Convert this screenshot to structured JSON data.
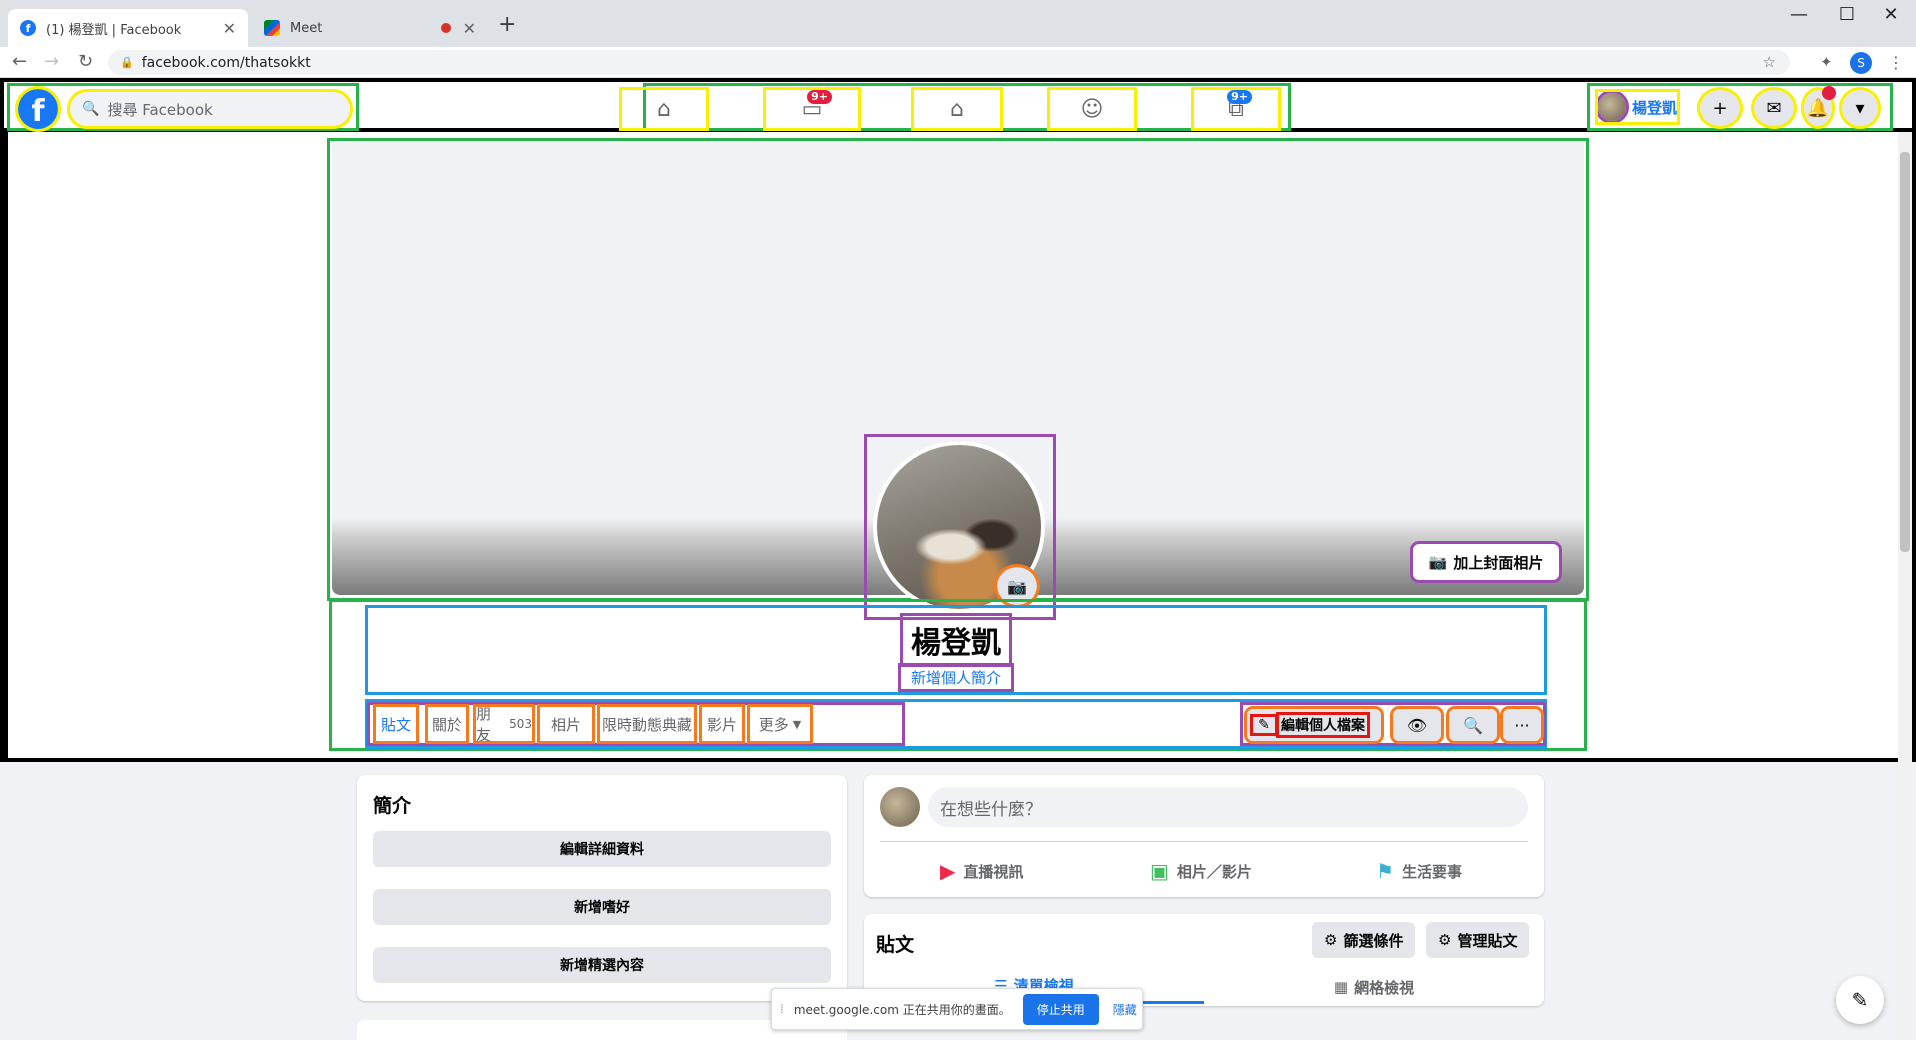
{
  "browser": {
    "tabs": [
      {
        "title": "(1) 楊登凱 | Facebook",
        "icon": "facebook-icon"
      },
      {
        "title": "Meet",
        "icon": "meet-icon"
      }
    ],
    "new_tab": "+",
    "url": "facebook.com/thatsokkt",
    "profile_initial": "S"
  },
  "fb_header": {
    "logo": "f",
    "search_placeholder": "搜尋 Facebook",
    "nav": [
      {
        "name": "home",
        "icon": "home-icon",
        "badge": ""
      },
      {
        "name": "watch",
        "icon": "video-icon",
        "badge": "9+"
      },
      {
        "name": "marketplace",
        "icon": "store-icon",
        "badge": ""
      },
      {
        "name": "groups",
        "icon": "groups-icon",
        "badge": ""
      },
      {
        "name": "gaming",
        "icon": "gaming-icon",
        "badge": "9+"
      }
    ],
    "profile_name": "楊登凱"
  },
  "profile": {
    "add_cover_label": "加上封面相片",
    "name": "楊登凱",
    "add_bio": "新增個人簡介",
    "tabs": [
      {
        "label": "貼文",
        "count": ""
      },
      {
        "label": "關於",
        "count": ""
      },
      {
        "label": "朋友",
        "count": "503"
      },
      {
        "label": "相片",
        "count": ""
      },
      {
        "label": "限時動態典藏",
        "count": ""
      },
      {
        "label": "影片",
        "count": ""
      },
      {
        "label": "更多",
        "count": ""
      }
    ],
    "edit_profile": "編輯個人檔案"
  },
  "intro": {
    "title": "簡介",
    "buttons": [
      "編輯詳細資料",
      "新增嗜好",
      "新增精選內容"
    ]
  },
  "composer": {
    "placeholder": "在想些什麼？",
    "actions": [
      "直播視訊",
      "相片／影片",
      "生活要事"
    ]
  },
  "posts": {
    "title": "貼文",
    "filter": "篩選條件",
    "manage": "管理貼文",
    "views": [
      "清單檢視",
      "網格檢視"
    ]
  },
  "share_bar": {
    "message": "meet.google.com 正在共用你的畫面。",
    "stop": "停止共用",
    "hide": "隱藏"
  },
  "colors": {
    "fb_blue": "#1877f2",
    "highlight_yellow": "#f7f000",
    "highlight_green": "#27b34a",
    "highlight_purple": "#9b4bb0",
    "highlight_orange": "#f57a1f",
    "highlight_blue": "#1e9be0",
    "highlight_red": "#e8140f"
  }
}
